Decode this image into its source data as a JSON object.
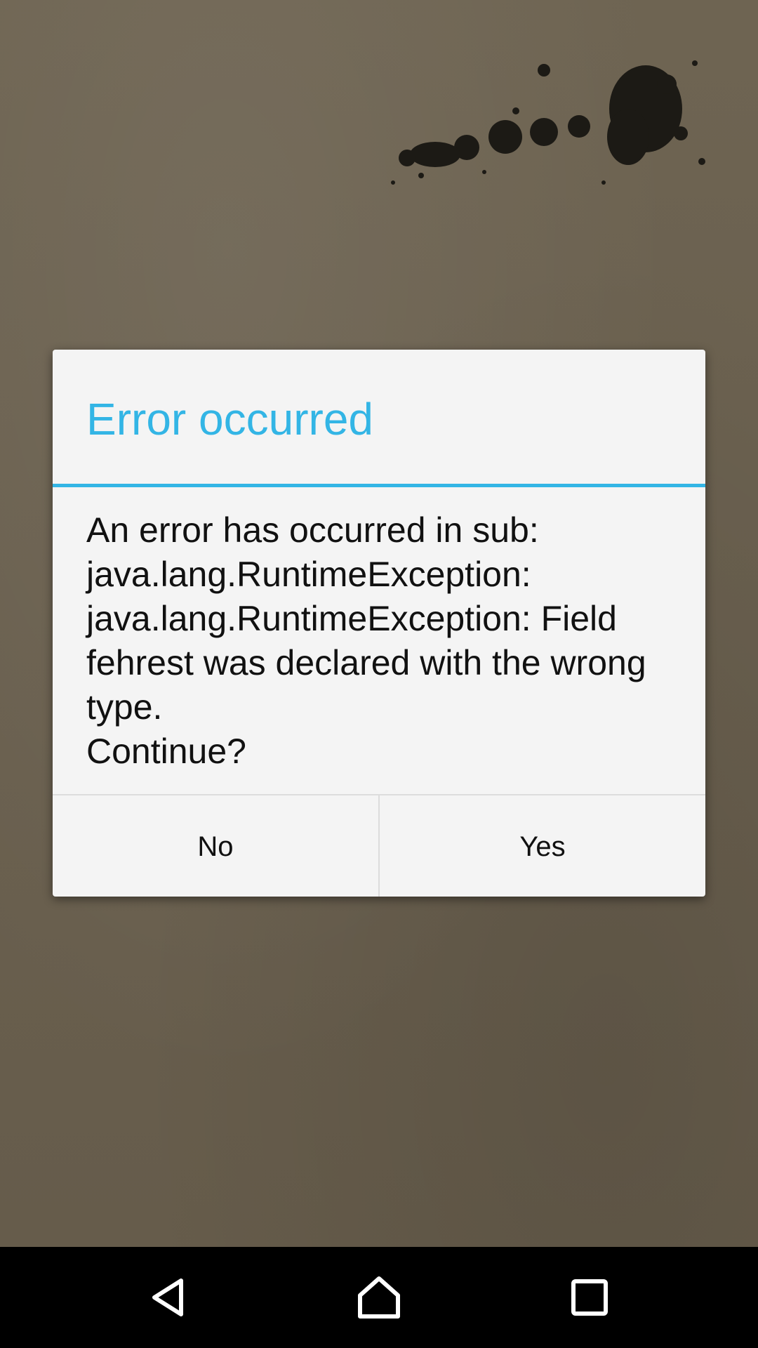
{
  "dialog": {
    "title": "Error occurred",
    "message": "An error has occurred in sub:\njava.lang.RuntimeException:\njava.lang.RuntimeException: Field fehrest was declared with the wrong type.\nContinue?",
    "buttons": {
      "no_label": "No",
      "yes_label": "Yes"
    }
  },
  "navigation": {
    "icons": [
      "back-icon",
      "home-icon",
      "recents-icon"
    ]
  },
  "colors": {
    "accent": "#33b5e5",
    "dialog_bg": "#f4f4f4",
    "background": "#6b6150",
    "nav_bar": "#000000"
  }
}
